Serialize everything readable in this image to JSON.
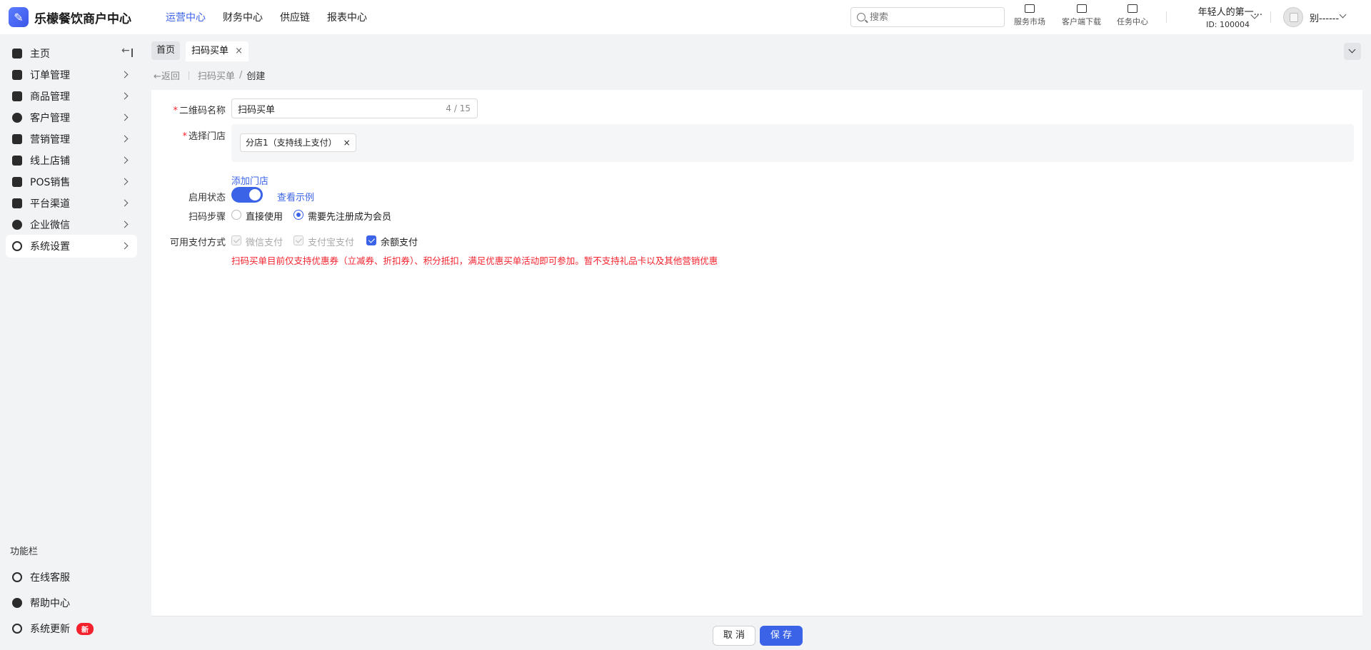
{
  "brand": {
    "name": "乐檬餐饮商户中心",
    "logo_icon": "brand-logo-icon"
  },
  "top_nav": [
    {
      "label": "运营中心",
      "active": true
    },
    {
      "label": "财务中心",
      "active": false
    },
    {
      "label": "供应链",
      "active": false
    },
    {
      "label": "报表中心",
      "active": false
    }
  ],
  "search": {
    "placeholder": "搜索"
  },
  "tools": [
    {
      "label": "服务市场",
      "icon": "shop-icon"
    },
    {
      "label": "客户端下载",
      "icon": "folder-download-icon"
    },
    {
      "label": "任务中心",
      "icon": "clipboard-icon"
    }
  ],
  "account": {
    "name": "年轻人的第一...",
    "id": "ID: 100004"
  },
  "user": {
    "name": "别------"
  },
  "sidebar": {
    "items": [
      {
        "label": "主页",
        "icon": "home-icon"
      },
      {
        "label": "订单管理",
        "icon": "order-icon"
      },
      {
        "label": "商品管理",
        "icon": "product-icon"
      },
      {
        "label": "客户管理",
        "icon": "user-icon"
      },
      {
        "label": "营销管理",
        "icon": "tag-icon"
      },
      {
        "label": "线上店铺",
        "icon": "store-icon"
      },
      {
        "label": "POS销售",
        "icon": "pos-icon"
      },
      {
        "label": "平台渠道",
        "icon": "channel-icon"
      },
      {
        "label": "企业微信",
        "icon": "wechat-icon"
      },
      {
        "label": "系统设置",
        "icon": "gear-icon"
      }
    ],
    "section_label": "功能栏",
    "bottom_items": [
      {
        "label": "在线客服",
        "icon": "headset-icon"
      },
      {
        "label": "帮助中心",
        "icon": "help-icon"
      },
      {
        "label": "系统更新",
        "icon": "refresh-icon",
        "badge": "新"
      }
    ]
  },
  "tabs": {
    "home": "首页",
    "current": "扫码买单",
    "close": "×"
  },
  "breadcrumb": {
    "back": "返回",
    "parent": "扫码买单",
    "separator": "/",
    "current": "创建"
  },
  "form": {
    "qr_name": {
      "label": "二维码名称",
      "value": "扫码买单",
      "counter": "4 / 15"
    },
    "store": {
      "label": "选择门店",
      "tag": "分店1（支持线上支付）",
      "tag_close": "×",
      "add_link": "添加门店"
    },
    "status": {
      "label": "启用状态",
      "enabled": true,
      "example_link": "查看示例"
    },
    "steps": {
      "label": "扫码步骤",
      "options": [
        "直接使用",
        "需要先注册成为会员"
      ],
      "selected": "需要先注册成为会员"
    },
    "payment": {
      "label": "可用支付方式",
      "options": [
        {
          "label": "微信支付",
          "checked": false,
          "disabled": true
        },
        {
          "label": "支付宝支付",
          "checked": false,
          "disabled": true
        },
        {
          "label": "余额支付",
          "checked": true,
          "disabled": false
        }
      ]
    },
    "warning": "扫码买单目前仅支持优惠券（立减券、折扣券）、积分抵扣，满足优惠买单活动即可参加。暂不支持礼品卡以及其他营销优惠"
  },
  "footer": {
    "cancel": "取 消",
    "save": "保 存"
  },
  "colors": {
    "primary": "#3b63e8",
    "danger": "#f5222d"
  }
}
